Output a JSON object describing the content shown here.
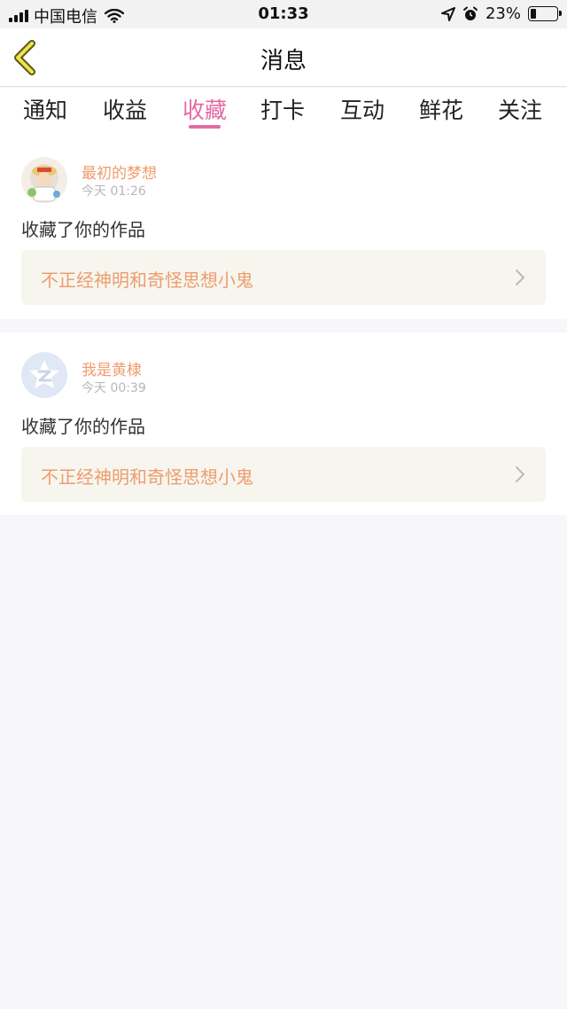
{
  "status_bar": {
    "carrier": "中国电信",
    "time": "01:33",
    "battery_text": "23%",
    "battery_level": 0.23
  },
  "nav": {
    "title": "消息"
  },
  "tabs": [
    {
      "label": "通知",
      "active": false
    },
    {
      "label": "收益",
      "active": false
    },
    {
      "label": "收藏",
      "active": true
    },
    {
      "label": "打卡",
      "active": false
    },
    {
      "label": "互动",
      "active": false
    },
    {
      "label": "鲜花",
      "active": false
    },
    {
      "label": "关注",
      "active": false
    }
  ],
  "notifications": [
    {
      "username": "最初的梦想",
      "time": "今天 01:26",
      "message": "收藏了你的作品",
      "work_title": "不正经神明和奇怪思想小鬼"
    },
    {
      "username": "我是黄棣",
      "time": "今天 00:39",
      "message": "收藏了你的作品",
      "work_title": "不正经神明和奇怪思想小鬼"
    }
  ],
  "colors": {
    "accent": "#e46aa3",
    "username": "#ef9c6e",
    "link_bg": "#f6f6ef",
    "page_bg": "#f7f6f9"
  }
}
